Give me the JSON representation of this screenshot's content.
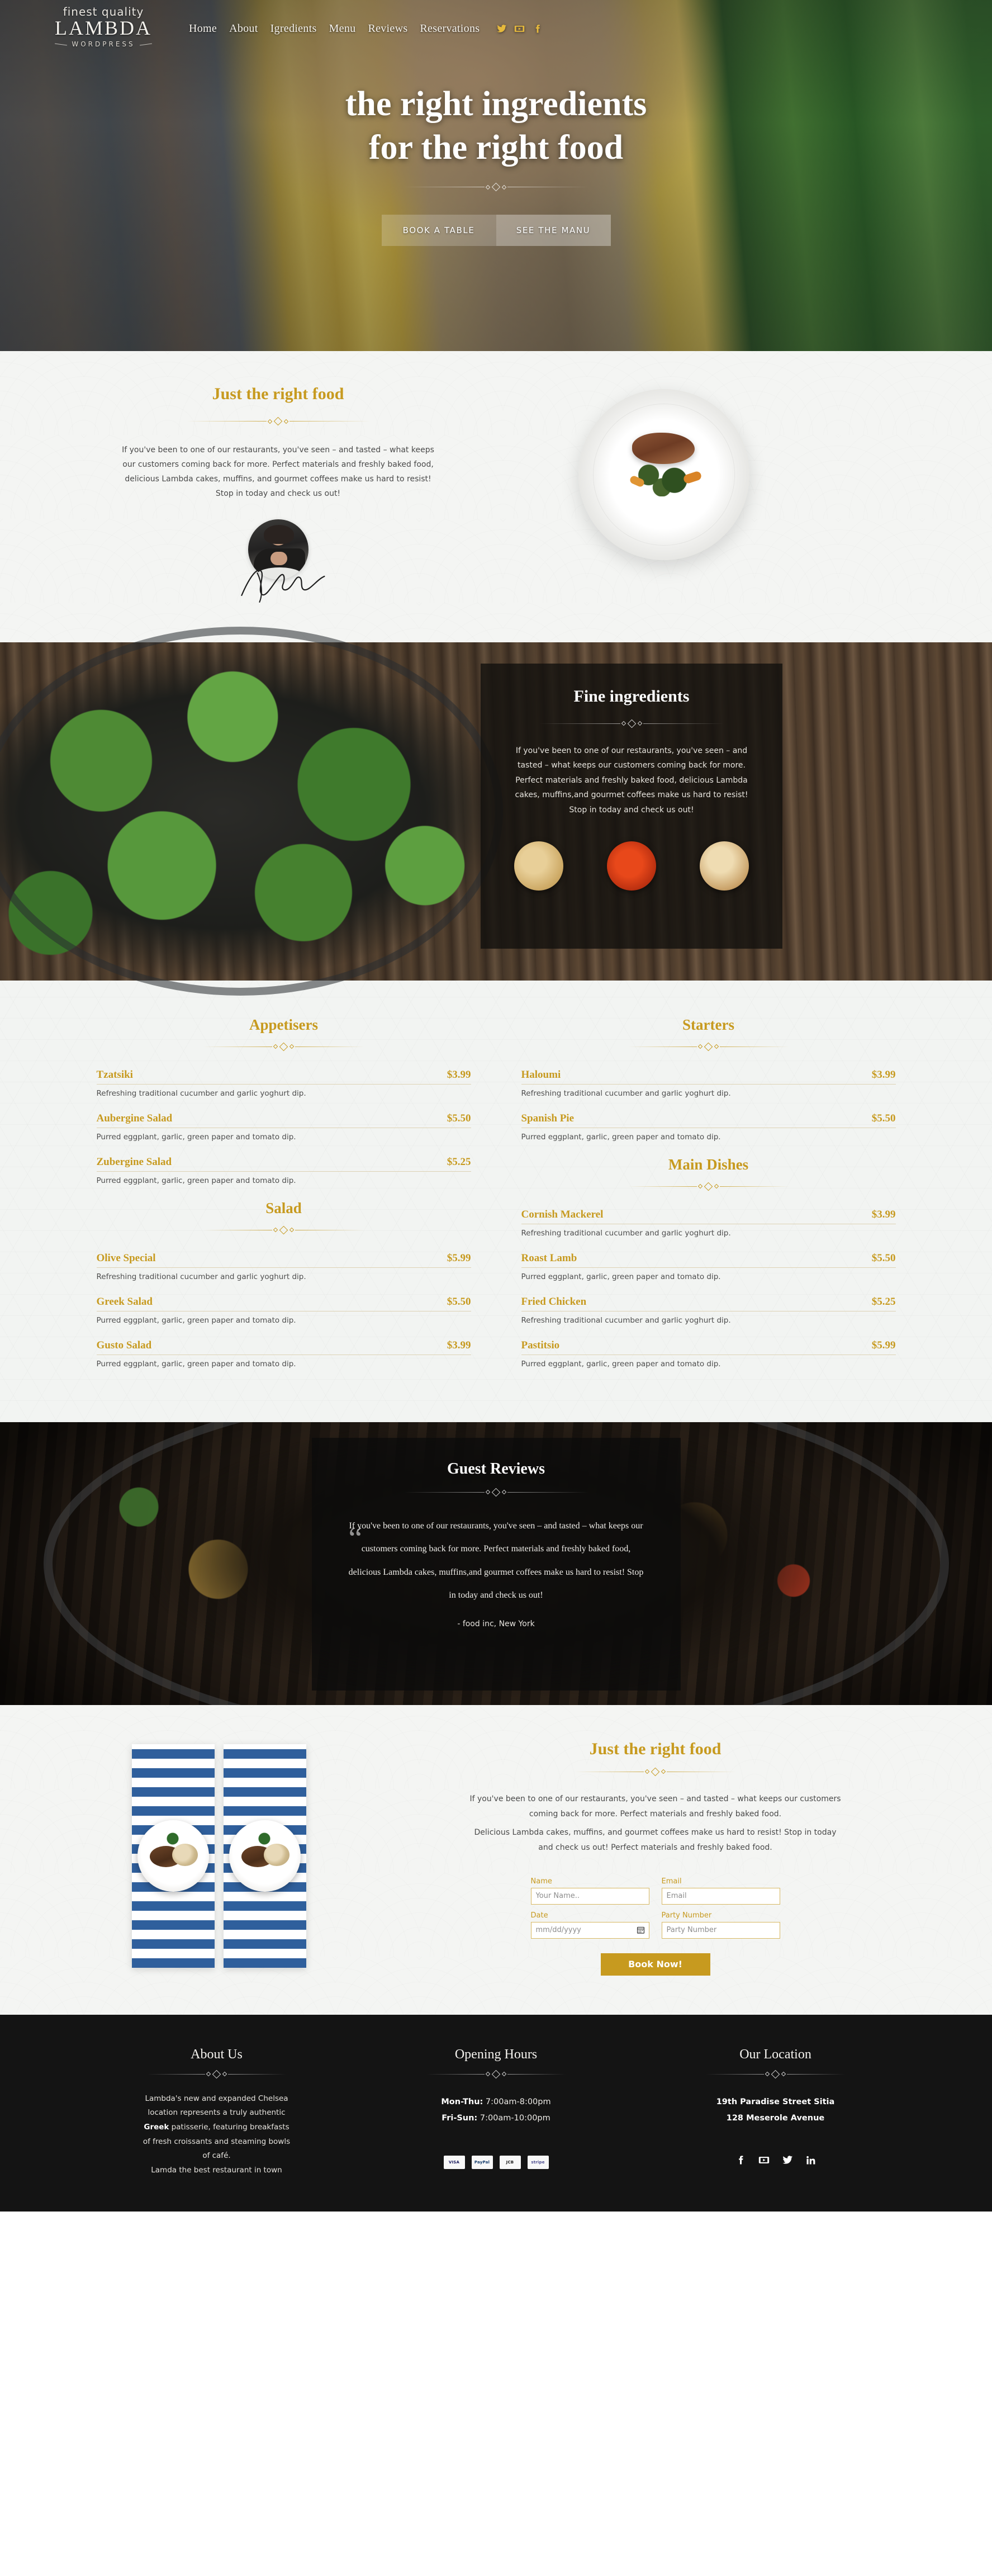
{
  "header": {
    "logo": {
      "top": "finest quality",
      "main": "LAMBDA",
      "sub": "WORDPRESS"
    },
    "nav": [
      {
        "label": "Home"
      },
      {
        "label": "About"
      },
      {
        "label": "Igredients"
      },
      {
        "label": "Menu"
      },
      {
        "label": "Reviews"
      },
      {
        "label": "Reservations"
      }
    ],
    "social": [
      {
        "name": "twitter-icon"
      },
      {
        "name": "youtube-icon"
      },
      {
        "name": "facebook-icon"
      }
    ]
  },
  "hero": {
    "title_line1": "the right ingredients",
    "title_line2": "for the right food",
    "btn_primary": "BOOK A TABLE",
    "btn_secondary": "SEE THE MANU"
  },
  "intro": {
    "title": "Just the right food",
    "body": "If you've been to one of our restaurants, you've seen – and tasted – what keeps our customers coming back for more. Perfect materials and freshly baked food, delicious Lambda cakes, muffins, and gourmet coffees make us hard to resist! Stop in today and check us out!"
  },
  "ingredients": {
    "title": "Fine ingredients",
    "body": "If you've been to one of our restaurants, you've seen – and tasted – what keeps our customers coming back for more. Perfect materials and freshly baked food, delicious Lambda cakes, muffins,and gourmet coffees make us hard to resist! Stop in today and check us out!",
    "thumbs": [
      {
        "name": "wheat-flour-thumb"
      },
      {
        "name": "red-spice-thumb"
      },
      {
        "name": "bread-thumb"
      }
    ]
  },
  "menu": {
    "columns": [
      {
        "groups": [
          {
            "title": "Appetisers",
            "items": [
              {
                "name": "Tzatsiki",
                "price": "$3.99",
                "desc": "Refreshing traditional cucumber and garlic yoghurt dip."
              },
              {
                "name": "Aubergine Salad",
                "price": "$5.50",
                "desc": "Purred eggplant, garlic, green paper and tomato dip."
              },
              {
                "name": "Zubergine Salad",
                "price": "$5.25",
                "desc": "Purred eggplant, garlic, green paper and tomato dip."
              }
            ]
          },
          {
            "title": "Salad",
            "items": [
              {
                "name": "Olive Special",
                "price": "$5.99",
                "desc": "Refreshing traditional cucumber and garlic yoghurt dip."
              },
              {
                "name": "Greek Salad",
                "price": "$5.50",
                "desc": "Purred eggplant, garlic, green paper and tomato dip."
              },
              {
                "name": "Gusto Salad",
                "price": "$3.99",
                "desc": "Purred eggplant, garlic, green paper and tomato dip."
              }
            ]
          }
        ]
      },
      {
        "groups": [
          {
            "title": "Starters",
            "items": [
              {
                "name": "Haloumi",
                "price": "$3.99",
                "desc": "Refreshing traditional cucumber and garlic yoghurt dip."
              },
              {
                "name": "Spanish Pie",
                "price": "$5.50",
                "desc": "Purred eggplant, garlic, green paper and tomato dip."
              }
            ]
          },
          {
            "title": "Main Dishes",
            "items": [
              {
                "name": "Cornish Mackerel",
                "price": "$3.99",
                "desc": "Refreshing traditional cucumber and garlic yoghurt dip."
              },
              {
                "name": "Roast Lamb",
                "price": "$5.50",
                "desc": "Purred eggplant, garlic, green paper and tomato dip."
              },
              {
                "name": "Fried Chicken",
                "price": "$5.25",
                "desc": "Refreshing traditional cucumber and garlic yoghurt dip."
              },
              {
                "name": "Pastitsio",
                "price": "$5.99",
                "desc": "Purred eggplant, garlic, green paper and tomato dip."
              }
            ]
          }
        ]
      }
    ]
  },
  "reviews": {
    "title": "Guest Reviews",
    "quote": "If you've been to one of our restaurants, you've seen – and tasted – what keeps our customers coming back for more. Perfect materials and freshly baked food, delicious Lambda cakes, muffins,and gourmet coffees make us hard to resist! Stop in today and check us out!",
    "author": "- food inc, New York"
  },
  "reservation": {
    "title": "Just the right food",
    "body_1": "If you've been to one of our restaurants, you've seen – and tasted – what keeps our customers coming back for more. Perfect materials and freshly baked food.",
    "body_2": "Delicious Lambda cakes, muffins, and gourmet coffees make us hard to resist! Stop in today and check us out! Perfect materials and freshly baked food.",
    "form": {
      "name_label": "Name",
      "name_placeholder": "Your Name..",
      "email_label": "Email",
      "email_placeholder": "Email",
      "date_label": "Date",
      "date_placeholder": "mm/dd/yyyy",
      "party_label": "Party Number",
      "party_placeholder": "Party Number",
      "submit": "Book Now!"
    }
  },
  "footer": {
    "about": {
      "title": "About Us",
      "line1": "Lambda's new and expanded Chelsea",
      "line2": "location represents a truly authentic",
      "strong": "Greek",
      "line3": " patisserie, featuring breakfasts",
      "line4": "of fresh croissants and steaming bowls",
      "line5": "of café.",
      "line6": "Lamda the best restaurant in town"
    },
    "hours": {
      "title": "Opening Hours",
      "row1_label": "Mon-Thu:",
      "row1_value": " 7:00am-8:00pm",
      "row2_label": "Fri-Sun:",
      "row2_value": " 7:00am-10:00pm",
      "payments": [
        {
          "name": "visa-icon",
          "label": "VISA"
        },
        {
          "name": "paypal-icon",
          "label": "PayPal"
        },
        {
          "name": "jcb-icon",
          "label": "JCB"
        },
        {
          "name": "stripe-icon",
          "label": "stripe"
        }
      ]
    },
    "location": {
      "title": "Our Location",
      "line1": "19th Paradise Street Sitia",
      "line2": "128 Meserole Avenue",
      "social": [
        {
          "name": "facebook-icon"
        },
        {
          "name": "youtube-icon"
        },
        {
          "name": "twitter-icon"
        },
        {
          "name": "linkedin-icon"
        }
      ]
    }
  }
}
